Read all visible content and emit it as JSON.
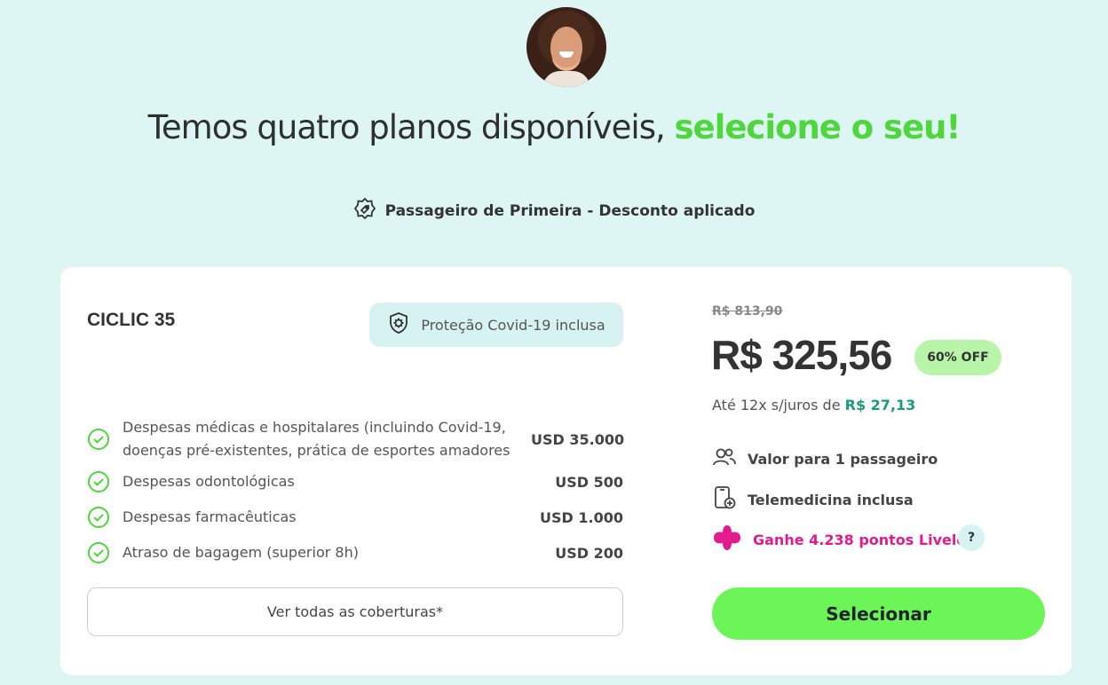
{
  "header": {
    "title_prefix": "Temos quatro planos disponíveis, ",
    "title_highlight": "selecione o seu!",
    "discount_label": "Passageiro de Primeira - Desconto aplicado"
  },
  "plan": {
    "name": "CICLIC 35",
    "covid_badge": "Proteção Covid-19 inclusa",
    "coverages": [
      {
        "label": "Despesas médicas e hospitalares (incluindo Covid-19, doenças pré-existentes, prática de esportes amadores e...",
        "value": "USD 35.000"
      },
      {
        "label": "Despesas odontológicas",
        "value": "USD 500"
      },
      {
        "label": "Despesas farmacêuticas",
        "value": "USD 1.000"
      },
      {
        "label": "Atraso de bagagem (superior 8h)",
        "value": "USD 200"
      }
    ],
    "see_all_label": "Ver todas as coberturas*",
    "old_price": "R$ 813,90",
    "price": "R$ 325,56",
    "discount_badge": "60% OFF",
    "installments_prefix": "Até 12x s/juros de ",
    "installments_amount": "R$ 27,13",
    "features": {
      "passengers": "Valor para 1 passageiro",
      "telemedicine": "Telemedicina inclusa",
      "livelo": "Ganhe 4.238 pontos Livelo"
    },
    "help_label": "?",
    "select_label": "Selecionar"
  },
  "colors": {
    "background": "#ddf6f4",
    "highlight_green": "#4ed63c",
    "select_button": "#6cf556",
    "livelo_pink": "#e21c8e",
    "installment_teal": "#1a9b7e"
  }
}
